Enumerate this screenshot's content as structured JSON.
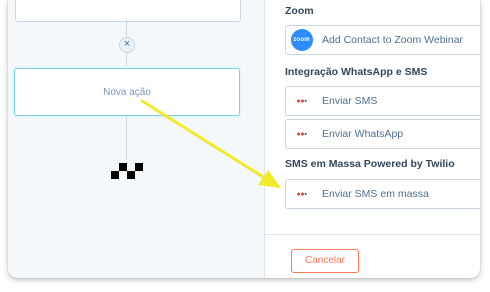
{
  "canvas": {
    "action_label": "Nova ação",
    "remove_glyph": "×"
  },
  "panel": {
    "sections": [
      {
        "title": "Zoom",
        "options": [
          {
            "label": "Add Contact to Zoom Webinar",
            "icon": "zoom-icon",
            "icon_text": "zoom"
          }
        ]
      },
      {
        "title": "Integração WhatsApp e SMS",
        "options": [
          {
            "label": "Enviar SMS",
            "icon": "sms-provider-icon"
          },
          {
            "label": "Enviar WhatsApp",
            "icon": "sms-provider-icon"
          }
        ]
      },
      {
        "title": "SMS em Massa Powered by Twilio",
        "options": [
          {
            "label": "Enviar SMS em massa",
            "icon": "sms-provider-icon"
          }
        ]
      }
    ],
    "cancel_label": "Cancelar"
  },
  "colors": {
    "accent_orange": "#ff7a59",
    "arrow_yellow": "#f2ea2c",
    "zoom_blue": "#2d8cff",
    "selected_border": "#7fd1de"
  }
}
